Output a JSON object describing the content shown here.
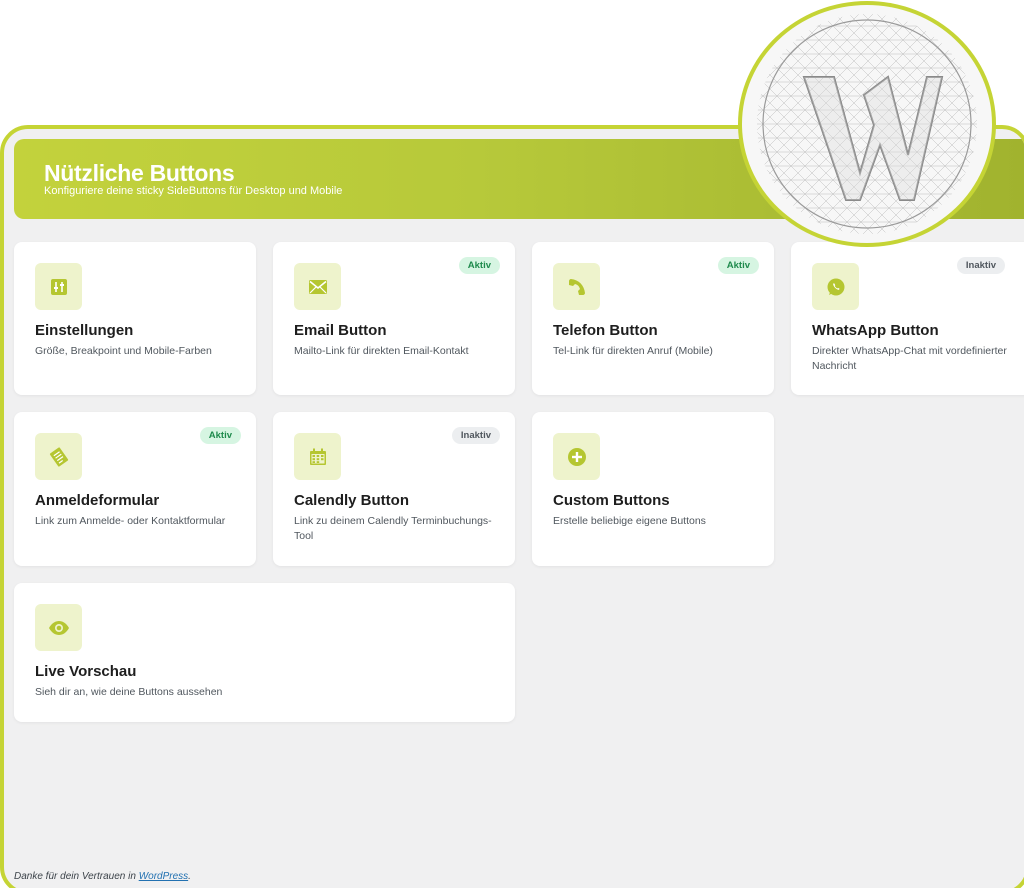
{
  "header": {
    "title": "Nützliche Buttons",
    "subtitle": "Konfiguriere deine sticky SideButtons für Desktop und Mobile"
  },
  "cards": [
    {
      "icon": "sliders-icon",
      "title": "Einstellungen",
      "desc": "Größe, Breakpoint und Mobile-Farben",
      "badge": ""
    },
    {
      "icon": "mail-icon",
      "title": "Email Button",
      "desc": "Mailto-Link für direkten Email-Kontakt",
      "badge": "Aktiv"
    },
    {
      "icon": "phone-icon",
      "title": "Telefon Button",
      "desc": "Tel-Link für direkten Anruf (Mobile)",
      "badge": "Aktiv"
    },
    {
      "icon": "whatsapp-icon",
      "title": "WhatsApp Button",
      "desc": "Direkter WhatsApp-Chat mit vordefinierter Nachricht",
      "badge": "Inaktiv"
    },
    {
      "icon": "form-icon",
      "title": "Anmeldeformular",
      "desc": "Link zum Anmelde- oder Kontaktformular",
      "badge": "Aktiv"
    },
    {
      "icon": "calendar-icon",
      "title": "Calendly Button",
      "desc": "Link zu deinem Calendly Terminbuchungs-Tool",
      "badge": "Inaktiv"
    },
    {
      "icon": "plus-circle-icon",
      "title": "Custom Buttons",
      "desc": "Erstelle beliebige eigene Buttons",
      "badge": ""
    },
    {
      "icon": "eye-icon",
      "title": "Live Vorschau",
      "desc": "Sieh dir an, wie deine Buttons aussehen",
      "badge": ""
    }
  ],
  "footer": {
    "text": "Danke für dein Vertrauen in ",
    "link": "WordPress",
    "suffix": "."
  },
  "colors": {
    "accent": "#c5d435",
    "icon": "#b5c631",
    "active_bg": "#d6f5e2",
    "active_text": "#1e8a4c"
  }
}
